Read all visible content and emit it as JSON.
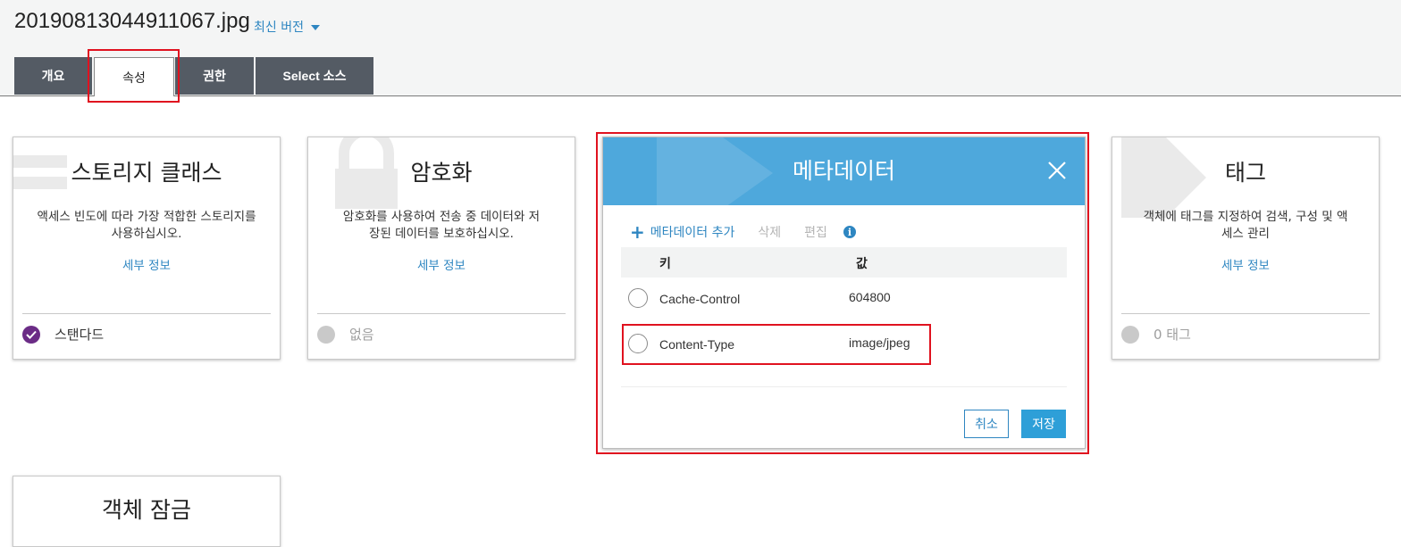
{
  "header": {
    "filename": "20190813044911067.jpg",
    "version_label": "최신 버전"
  },
  "tabs": [
    {
      "label": "개요"
    },
    {
      "label": "속성"
    },
    {
      "label": "권한"
    },
    {
      "label": "Select 소스"
    }
  ],
  "cards": {
    "storage": {
      "title": "스토리지 클래스",
      "desc_line1": "액세스 빈도에 따라 가장 적합한 스토리지를",
      "desc_line2": "사용하십시오.",
      "link": "세부 정보",
      "status": "스탠다드"
    },
    "encryption": {
      "title": "암호화",
      "desc_line1": "암호화를 사용하여 전송 중 데이터와 저",
      "desc_line2": "장된 데이터를 보호하십시오.",
      "link": "세부 정보",
      "status": "없음"
    },
    "tags": {
      "title": "태그",
      "desc_line1": "객체에 태그를 지정하여 검색, 구성 및 액",
      "desc_line2": "세스 관리",
      "link": "세부 정보",
      "status": "0 태그"
    },
    "object_lock": {
      "title": "객체 잠금"
    }
  },
  "metadata": {
    "title": "메타데이터",
    "toolbar": {
      "add": "메타데이터 추가",
      "delete": "삭제",
      "edit": "편집"
    },
    "columns": {
      "key": "키",
      "value": "값"
    },
    "rows": [
      {
        "key": "Cache-Control",
        "value": "604800"
      },
      {
        "key": "Content-Type",
        "value": "image/jpeg"
      }
    ],
    "cancel": "취소",
    "save": "저장"
  },
  "colors": {
    "tab_bg": "#545b64",
    "accent": "#2e86c1",
    "panel_header": "#4ea8dc",
    "highlight": "#e0121f",
    "check": "#6b2c86"
  }
}
